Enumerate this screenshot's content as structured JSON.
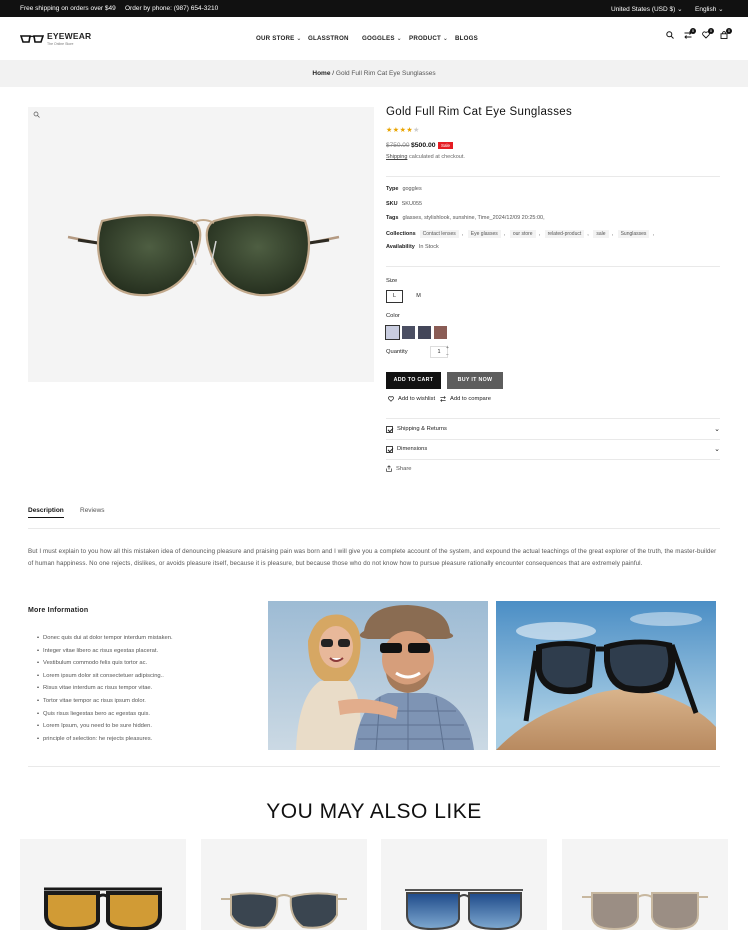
{
  "topbar": {
    "free_shipping": "Free shipping on orders over $49",
    "phone": "Order by phone: (987) 654-3210",
    "currency": "United States (USD $)",
    "language": "English"
  },
  "header": {
    "logo_title": "EYEWEAR",
    "logo_subtitle": "The Online Store",
    "nav": [
      "OUR STORE",
      "GLASSTRON",
      "GOGGLES",
      "PRODUCT",
      "BLOGS"
    ],
    "compare_count": "0",
    "wishlist_count": "0",
    "cart_count": "0"
  },
  "breadcrumb": {
    "home": "Home",
    "separator": "/",
    "current": "Gold Full Rim Cat Eye Sunglasses"
  },
  "product": {
    "title": "Gold Full Rim Cat Eye Sunglasses",
    "rating": 4,
    "rating_max": 5,
    "price_old": "$750.00",
    "price_new": "$500.00",
    "sale_badge": "Sale",
    "shipping_link": "Shipping",
    "shipping_text": "calculated at checkout.",
    "type_label": "Type",
    "type_value": "goggles",
    "sku_label": "SKU",
    "sku_value": "SKU055",
    "tags_label": "Tags",
    "tags_value": "glasses, stylishlook, sunshine, Time_2024/12/09 20:25:00,",
    "collections_label": "Collections",
    "collections": [
      "Contact lenses",
      "Eye glasses",
      "our store",
      "related-product",
      "sale",
      "Sunglasses"
    ],
    "availability_label": "Availability",
    "availability_value": "In Stock",
    "size_label": "Size",
    "sizes": [
      "L",
      "M"
    ],
    "selected_size": "L",
    "color_label": "Color",
    "colors": [
      "#c9cde0",
      "#4b4f63",
      "#434659",
      "#8a5c55"
    ],
    "quantity_label": "Quantity",
    "quantity": "1",
    "add_to_cart": "ADD TO CART",
    "buy_now": "BUY IT NOW",
    "add_to_wishlist": "Add to wishlist",
    "add_to_compare": "Add to compare",
    "shipping_returns": "Shipping & Returns",
    "dimensions": "Dimensions",
    "share": "Share"
  },
  "tabs": {
    "description": "Description",
    "reviews": "Reviews"
  },
  "description": {
    "text": "But I must explain to you how all this mistaken idea of denouncing pleasure and praising pain was born and I will give you a complete account of the system, and expound the actual teachings of the great explorer of the truth, the master-builder of human happiness. No one rejects, dislikes, or avoids pleasure itself, because it is pleasure, but because those who do not know how to pursue pleasure rationally encounter consequences that are extremely painful.",
    "more_info_title": "More Information",
    "bullets": [
      "Donec quis dui at dolor tempor interdum mistaken.",
      "Integer vitae libero ac risus egestas placerat.",
      "Vestibulum commodo felis quis tortor ac.",
      "Lorem ipsum dolor sit consectetuer adipiscing..",
      "Risus vitae interdum ac risus tempor vitae.",
      "Tortor vitae tempor ac risus ipsum dolor.",
      "Quis risus liegestas bero ac egestas quis.",
      "Lorem Ipsum, you need to be sure hidden.",
      "principle of selection: he rejects pleasures."
    ]
  },
  "related": {
    "title": "YOU MAY ALSO LIKE"
  },
  "colors": {
    "sale": "#e51c23",
    "primary": "#111111",
    "buy_now": "#5d5d5d",
    "star": "#e9a400"
  }
}
